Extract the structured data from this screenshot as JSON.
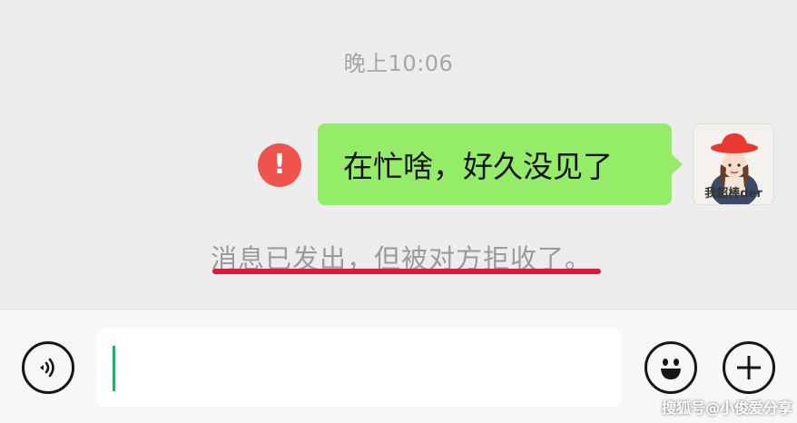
{
  "chat": {
    "timestamp": "晚上10:06",
    "message": {
      "text": "在忙啥，好久没见了",
      "status_icon": "error-exclamation-icon",
      "bubble_color": "#95ec69",
      "error_color": "#f0524d"
    },
    "avatar": {
      "caption": "我超棒der"
    },
    "system_notice": "消息已发出，但被对方拒收了。",
    "annotation_color": "#e0143c"
  },
  "input_bar": {
    "voice_icon": "voice-icon",
    "text_value": "",
    "emoji_icon": "emoji-icon",
    "plus_icon": "plus-icon",
    "caret_color": "#07c160"
  },
  "watermark": "搜狐号@小俊爱分享"
}
